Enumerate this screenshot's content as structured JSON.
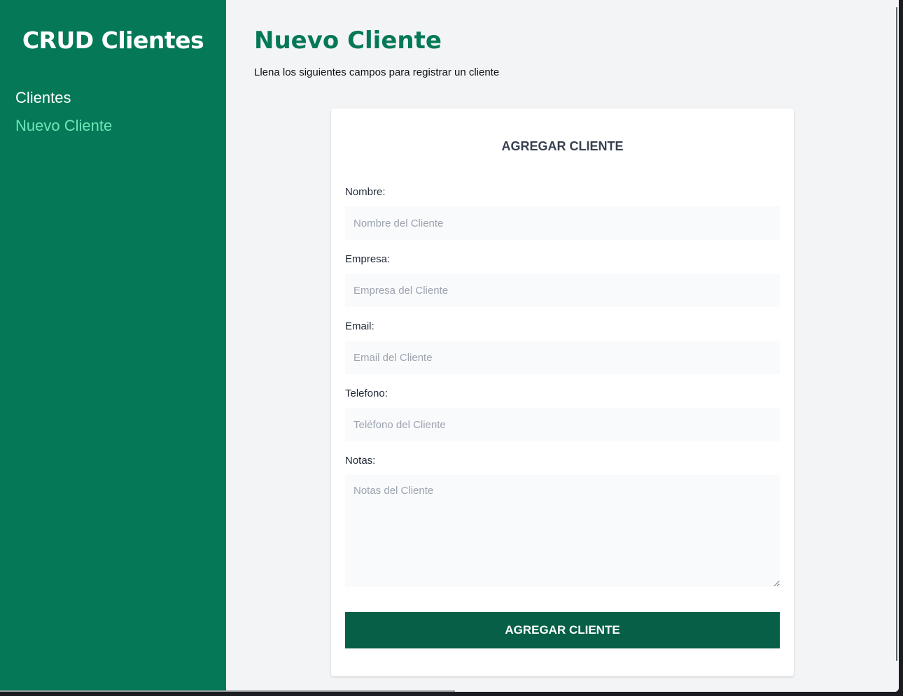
{
  "sidebar": {
    "brand": "CRUD Clientes",
    "items": [
      {
        "label": "Clientes",
        "active": false
      },
      {
        "label": "Nuevo Cliente",
        "active": true
      }
    ]
  },
  "page": {
    "title": "Nuevo Cliente",
    "subtitle": "Llena los siguientes campos para registrar un cliente"
  },
  "form": {
    "title": "AGREGAR CLIENTE",
    "fields": [
      {
        "label": "Nombre:",
        "placeholder": "Nombre del Cliente",
        "value": ""
      },
      {
        "label": "Empresa:",
        "placeholder": "Empresa del Cliente",
        "value": ""
      },
      {
        "label": "Email:",
        "placeholder": "Email del Cliente",
        "value": ""
      },
      {
        "label": "Telefono:",
        "placeholder": "Teléfono del Cliente",
        "value": ""
      },
      {
        "label": "Notas:",
        "placeholder": "Notas del Cliente",
        "value": ""
      }
    ],
    "submit_label": "AGREGAR CLIENTE"
  },
  "colors": {
    "sidebar_bg": "#047857",
    "active_link": "#6ee7b7",
    "title": "#047857",
    "button_bg": "#065f46",
    "page_bg": "#f3f4f6"
  }
}
